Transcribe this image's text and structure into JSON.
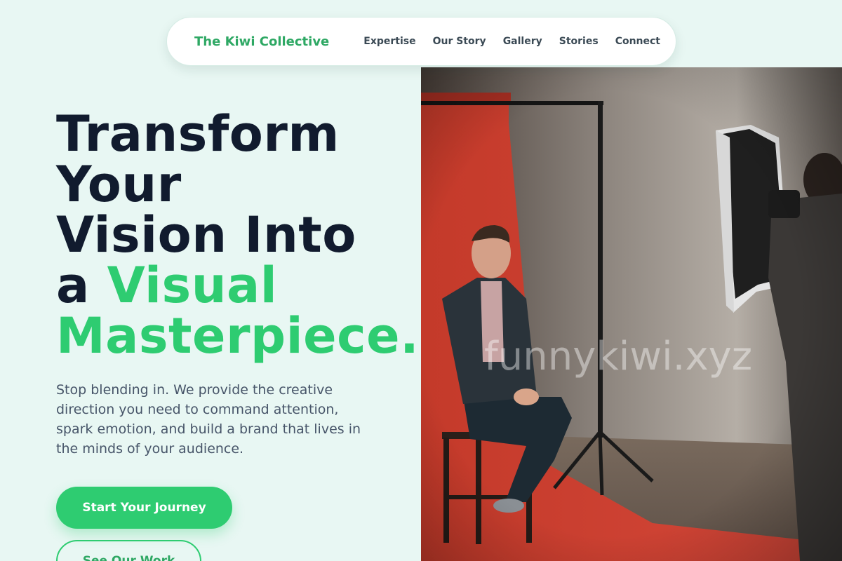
{
  "nav": {
    "brand": "The Kiwi Collective",
    "links": [
      "Expertise",
      "Our Story",
      "Gallery",
      "Stories",
      "Connect"
    ]
  },
  "hero": {
    "title_lines": [
      "Transform",
      "Your",
      "Vision Into"
    ],
    "title_line4_plain": "a ",
    "title_line4_accent": "Visual",
    "title_line5_accent": "Masterpiece.",
    "subtitle": "Stop blending in. We provide the creative direction you need to command attention, spark emotion, and build a brand that lives in the minds of your audience.",
    "primary_cta": "Start Your Journey",
    "secondary_cta": "See Our Work",
    "watermark": "funnykiwi.xyz"
  },
  "colors": {
    "background": "#e8f7f3",
    "accent": "#2ecc71",
    "brand": "#2ea864",
    "heading": "#111b2e",
    "body": "#475569"
  }
}
